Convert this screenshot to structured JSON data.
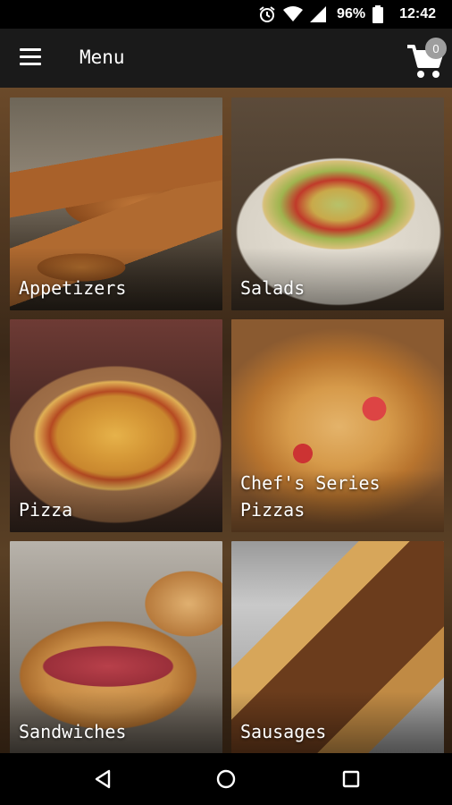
{
  "status_bar": {
    "icons": [
      "alarm-icon",
      "wifi-icon",
      "signal-icon",
      "battery-icon"
    ],
    "battery_percent": "96%",
    "time": "12:42"
  },
  "app_bar": {
    "menu_icon": "hamburger-menu-icon",
    "title": "Menu",
    "cart_icon": "shopping-cart-icon",
    "cart_count": "0"
  },
  "categories": [
    {
      "label": "Appetizers"
    },
    {
      "label": "Salads"
    },
    {
      "label": "Pizza"
    },
    {
      "label": "Chef's Series\nPizzas"
    },
    {
      "label": "Sandwiches"
    },
    {
      "label": "Sausages"
    }
  ],
  "nav_bar": {
    "icons": [
      "back-triangle-icon",
      "home-circle-icon",
      "recents-square-icon"
    ]
  }
}
